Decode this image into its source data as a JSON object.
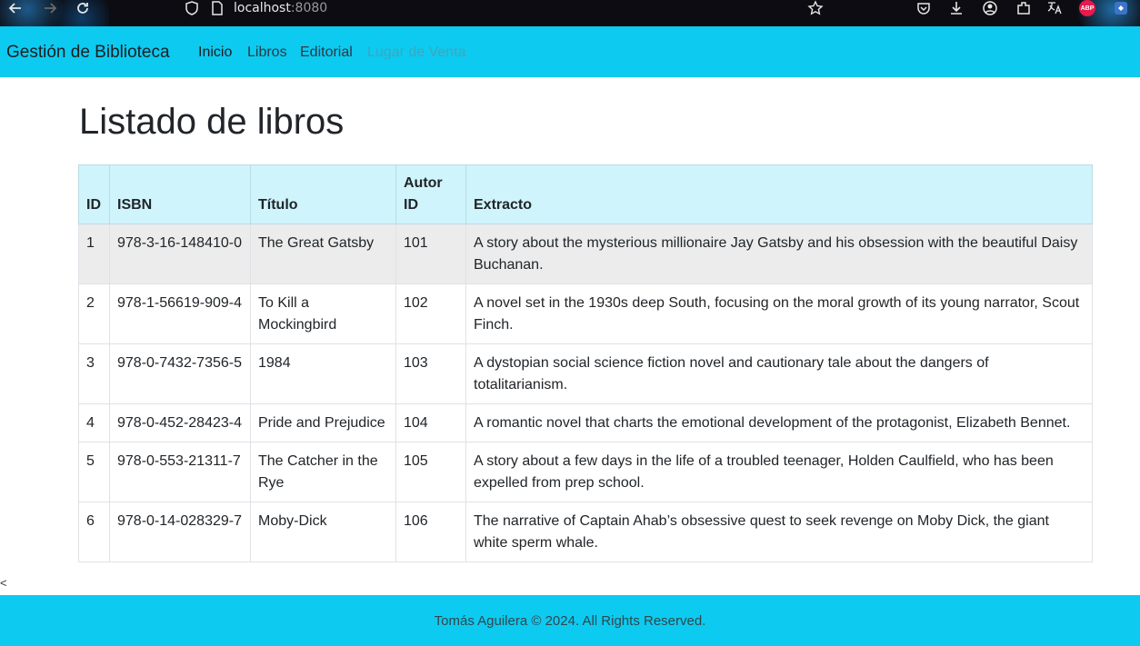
{
  "browser": {
    "url_host": "localhost",
    "url_port": ":8080",
    "abp_label": "ABP"
  },
  "navbar": {
    "brand": "Gestión de Biblioteca",
    "links": [
      "Inicio",
      "Libros",
      "Editorial",
      "Lugar de Venta"
    ]
  },
  "main": {
    "title": "Listado de libros",
    "table": {
      "headers": [
        "ID",
        "ISBN",
        "Título",
        "Autor ID",
        "Extracto"
      ],
      "rows": [
        [
          "1",
          "978-3-16-148410-0",
          "The Great Gatsby",
          "101",
          "A story about the mysterious millionaire Jay Gatsby and his obsession with the beautiful Daisy Buchanan."
        ],
        [
          "2",
          "978-1-56619-909-4",
          "To Kill a Mockingbird",
          "102",
          "A novel set in the 1930s deep South, focusing on the moral growth of its young narrator, Scout Finch."
        ],
        [
          "3",
          "978-0-7432-7356-5",
          "1984",
          "103",
          "A dystopian social science fiction novel and cautionary tale about the dangers of totalitarianism."
        ],
        [
          "4",
          "978-0-452-28423-4",
          "Pride and Prejudice",
          "104",
          "A romantic novel that charts the emotional development of the protagonist, Elizabeth Bennet."
        ],
        [
          "5",
          "978-0-553-21311-7",
          "The Catcher in the Rye",
          "105",
          "A story about a few days in the life of a troubled teenager, Holden Caulfield, who has been expelled from prep school."
        ],
        [
          "6",
          "978-0-14-028329-7",
          "Moby-Dick",
          "106",
          "The narrative of Captain Ahab’s obsessive quest to seek revenge on Moby Dick, the giant white sperm whale."
        ]
      ]
    },
    "stray_char": "<"
  },
  "footer": {
    "text": "Tomás Aguilera © 2024. All Rights Reserved."
  },
  "colors": {
    "navbar": "#0dcaf0",
    "table_header": "#cff4fc",
    "stripe_row": "#ececec",
    "chrome": "#0c0c12",
    "abp": "#e8194b"
  },
  "icons": [
    "back-arrow-icon",
    "forward-arrow-icon",
    "reload-icon",
    "shield-icon",
    "page-icon",
    "star-icon",
    "pocket-icon",
    "download-icon",
    "account-icon",
    "extensions-icon",
    "translate-icon",
    "abp-icon",
    "extension-icon"
  ]
}
